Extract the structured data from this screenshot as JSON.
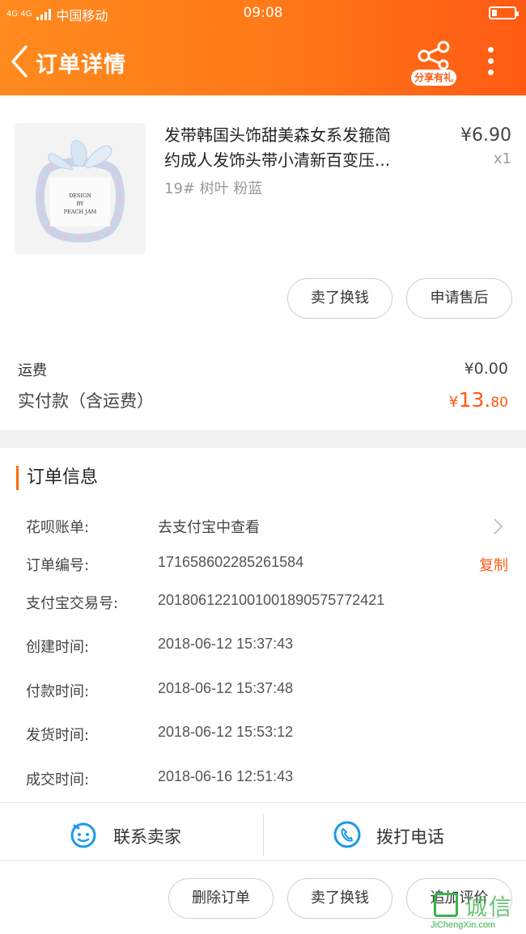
{
  "status_bar": {
    "network": "4G 4G",
    "carrier": "中国移动",
    "time": "09:08"
  },
  "header": {
    "title": "订单详情",
    "share_label": "分享有礼"
  },
  "product": {
    "title_line1": "发带韩国头饰甜美森女系发箍简",
    "title_line2": "约成人发饰头带小清新百变压...",
    "sku": "19# 树叶 粉蓝",
    "price": "¥6.90",
    "quantity": "x1",
    "image_text": [
      "DESIGN",
      "BY",
      "PEACH JAM"
    ]
  },
  "product_actions": {
    "resell": "卖了换钱",
    "after_sale": "申请售后"
  },
  "summary": {
    "shipping_label": "运费",
    "shipping_value": "¥0.00",
    "paid_label": "实付款（含运费）",
    "paid_currency": "¥",
    "paid_integer": "13.",
    "paid_decimal": "80"
  },
  "order_info": {
    "section_title": "订单信息",
    "huabei_label": "花呗账单:",
    "huabei_value": "去支付宝中查看",
    "order_no_label": "订单编号:",
    "order_no_value": "171658602285261584",
    "copy_label": "复制",
    "alipay_no_label": "支付宝交易号:",
    "alipay_no_value": "2018061221001001890575772421",
    "created_label": "创建时间:",
    "created_value": "2018-06-12 15:37:43",
    "paid_time_label": "付款时间:",
    "paid_time_value": "2018-06-12 15:37:48",
    "shipped_label": "发货时间:",
    "shipped_value": "2018-06-12 15:53:12",
    "done_label": "成交时间:",
    "done_value": "2018-06-16 12:51:43"
  },
  "bottom": {
    "contact_seller": "联系卖家",
    "call_phone": "拨打电话",
    "delete_order": "删除订单",
    "resell": "卖了换钱",
    "add_review": "追加评价"
  },
  "watermark": {
    "text": "诚信",
    "url": "JiChengXin.com"
  },
  "colors": {
    "accent": "#ff6a14",
    "header_start": "#ff8a1e",
    "header_end": "#ff5a14",
    "icon_blue": "#1a9be6"
  }
}
